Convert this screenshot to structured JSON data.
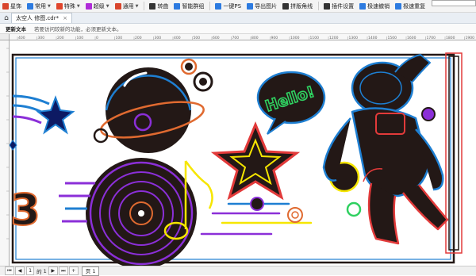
{
  "toolbar": {
    "items": [
      {
        "label": "星饰",
        "icon": "star-tool-icon",
        "color": "#d8452c",
        "dropdown": false
      },
      {
        "label": "常用",
        "icon": "common-icon",
        "color": "#2d7be0",
        "dropdown": true
      },
      {
        "label": "特殊",
        "icon": "special-icon",
        "color": "#e0452c",
        "dropdown": true
      },
      {
        "label": "超级",
        "icon": "super-icon",
        "color": "#b02cd8",
        "dropdown": true
      },
      {
        "label": "通用",
        "icon": "general-icon",
        "color": "#d8452c",
        "dropdown": true
      },
      {
        "label": "转曲",
        "icon": "convert-curve-icon",
        "color": "#333333",
        "dropdown": false
      },
      {
        "label": "智能群组",
        "icon": "smart-group-icon",
        "color": "#2d7be0",
        "dropdown": false
      },
      {
        "label": "一键PS",
        "icon": "photoshop-icon",
        "color": "#2d7be0",
        "dropdown": false
      },
      {
        "label": "导出图片",
        "icon": "export-image-icon",
        "color": "#2d7be0",
        "dropdown": false
      },
      {
        "label": "拼版角线",
        "icon": "crop-marks-icon",
        "color": "#333333",
        "dropdown": false
      },
      {
        "label": "插件设置",
        "icon": "gear-icon",
        "color": "#333333",
        "dropdown": false
      },
      {
        "label": "极速撤销",
        "icon": "undo-icon",
        "color": "#2d7be0",
        "dropdown": false
      },
      {
        "label": "极速重复",
        "icon": "redo-icon",
        "color": "#2d7be0",
        "dropdown": false
      }
    ]
  },
  "tabbar": {
    "document_tab": "太空人 修图.cdr*",
    "close": "×"
  },
  "hint": {
    "title": "更新文本",
    "text": "若要访问较新的功能，必须更新文本。"
  },
  "ruler": {
    "ticks": [
      "400",
      "300",
      "200",
      "100",
      "0",
      "100",
      "200",
      "300",
      "400",
      "500",
      "600",
      "700",
      "800",
      "900",
      "1000",
      "1100",
      "1200",
      "1300",
      "1400",
      "1500",
      "1600",
      "1700",
      "1800",
      "1900"
    ]
  },
  "artwork": {
    "hello_text": "Hello!",
    "number_text": "3"
  },
  "status": {
    "page_current": "1",
    "of_label": "的",
    "page_total": "1",
    "page_tab": "页 1"
  },
  "colors": {
    "background": "#ffffff",
    "dark_fill": "#231816",
    "neon_blue": "#1e7fd2",
    "neon_purple": "#8b2fd8",
    "neon_red": "#e23a3a",
    "neon_yellow": "#f6e600",
    "neon_green": "#2fd060",
    "neon_orange": "#e06a30"
  }
}
